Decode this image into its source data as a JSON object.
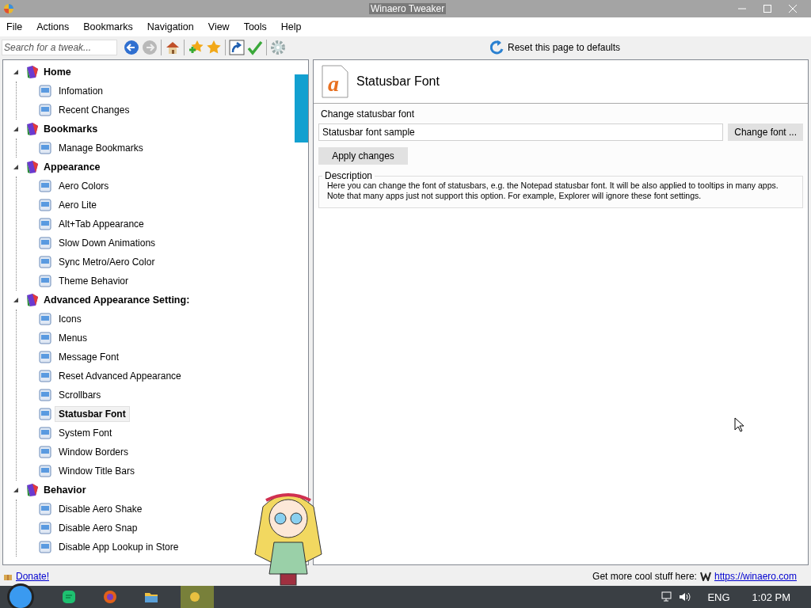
{
  "window": {
    "title": "Winaero Tweaker"
  },
  "menu": [
    "File",
    "Actions",
    "Bookmarks",
    "Navigation",
    "View",
    "Tools",
    "Help"
  ],
  "search": {
    "placeholder": "Search for a tweak..."
  },
  "reset_link": "Reset this page to defaults",
  "tree": [
    {
      "label": "Home",
      "expanded": true,
      "children": [
        {
          "label": "Infomation",
          "selected": false
        },
        {
          "label": "Recent Changes",
          "selected": false
        }
      ]
    },
    {
      "label": "Bookmarks",
      "expanded": true,
      "children": [
        {
          "label": "Manage Bookmarks",
          "selected": false
        }
      ]
    },
    {
      "label": "Appearance",
      "expanded": true,
      "children": [
        {
          "label": "Aero Colors",
          "selected": false
        },
        {
          "label": "Aero Lite",
          "selected": false
        },
        {
          "label": "Alt+Tab Appearance",
          "selected": false
        },
        {
          "label": "Slow Down Animations",
          "selected": false
        },
        {
          "label": "Sync Metro/Aero Color",
          "selected": false
        },
        {
          "label": "Theme Behavior",
          "selected": false
        }
      ]
    },
    {
      "label": "Advanced Appearance Setting:",
      "expanded": true,
      "children": [
        {
          "label": "Icons",
          "selected": false
        },
        {
          "label": "Menus",
          "selected": false
        },
        {
          "label": "Message Font",
          "selected": false
        },
        {
          "label": "Reset Advanced Appearance",
          "selected": false
        },
        {
          "label": "Scrollbars",
          "selected": false
        },
        {
          "label": "Statusbar Font",
          "selected": true
        },
        {
          "label": "System Font",
          "selected": false
        },
        {
          "label": "Window Borders",
          "selected": false
        },
        {
          "label": "Window Title Bars",
          "selected": false
        }
      ]
    },
    {
      "label": "Behavior",
      "expanded": true,
      "children": [
        {
          "label": "Disable Aero Shake",
          "selected": false
        },
        {
          "label": "Disable Aero Snap",
          "selected": false
        },
        {
          "label": "Disable App Lookup in Store",
          "selected": false
        }
      ]
    }
  ],
  "page": {
    "icon_letter": "a",
    "title": "Statusbar Font",
    "field_label": "Change statusbar font",
    "field_value": "Statusbar font sample",
    "change_button": "Change font ...",
    "apply_button": "Apply changes",
    "description_title": "Description",
    "description": [
      "Here you can change the font of statusbars, e.g. the Notepad statusbar font. It will be also applied to tooltips in many apps.",
      "Note that many apps just not support this option. For example, Explorer will ignore these font settings."
    ]
  },
  "status_bar": {
    "donate": "Donate!",
    "promo": "Get more cool stuff here:",
    "link": "https://winaero.com"
  },
  "taskbar": {
    "language": "ENG",
    "time": "1:02 PM"
  }
}
